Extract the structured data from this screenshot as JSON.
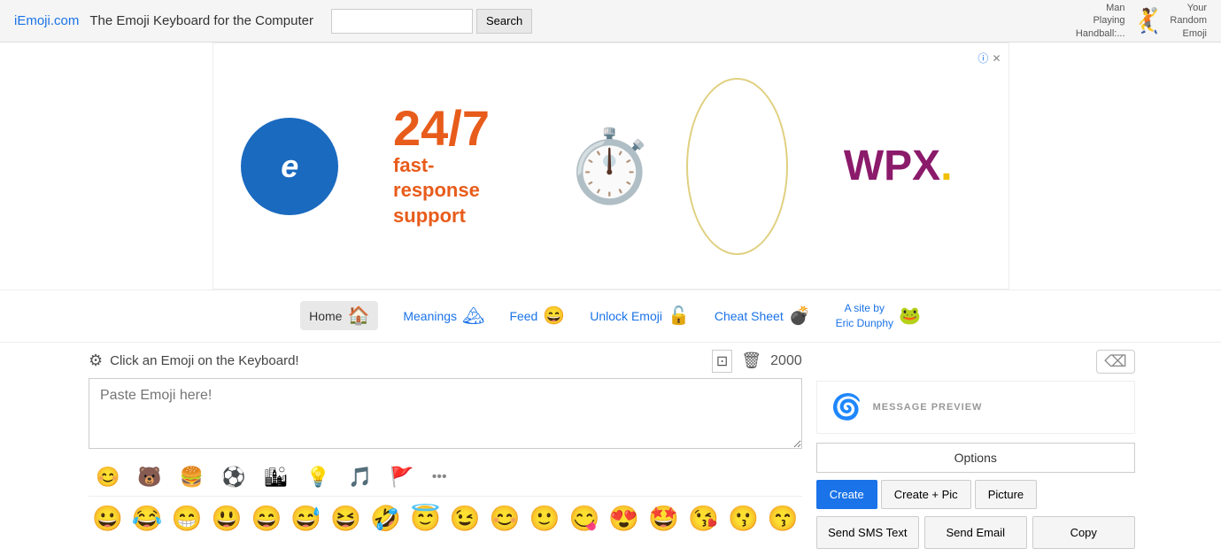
{
  "header": {
    "site_link": "iEmoji.com",
    "tagline": "The Emoji Keyboard for the Computer",
    "search_placeholder": "",
    "search_btn": "Search",
    "random_lines": [
      "Man",
      "Playing",
      "Handball:..."
    ],
    "random_label": "Your\nRandom\nEmoji",
    "random_emoji": "🤾"
  },
  "ad": {
    "highlight": "24/7",
    "support": "fast-response\nsupport",
    "brand": "WPX.",
    "close_label": "×",
    "info_label": "ⓘ"
  },
  "nav": {
    "items": [
      {
        "id": "home",
        "label": "Home",
        "emoji": "🏠",
        "active": true
      },
      {
        "id": "meanings",
        "label": "Meanings",
        "emoji": "🏔",
        "active": false
      },
      {
        "id": "feed",
        "label": "Feed",
        "emoji": "😄",
        "active": false
      },
      {
        "id": "unlock",
        "label": "Unlock Emoji",
        "emoji": "🔓",
        "active": false
      },
      {
        "id": "cheatsheet",
        "label": "Cheat Sheet",
        "emoji": "💣",
        "active": false
      },
      {
        "id": "siteby",
        "label": "A site by\nEric Dunphy",
        "emoji": "🐸",
        "active": false
      }
    ]
  },
  "keyboard": {
    "title": "Click an Emoji on the Keyboard!",
    "placeholder": "Paste Emoji here!",
    "char_count": "2000",
    "settings_icon": "⚙",
    "copy_icon": "⊡",
    "trash_icon": "🗑",
    "tabs": [
      "😊",
      "🐻",
      "🍔",
      "⚽",
      "🏙",
      "💡",
      "🎵",
      "🚩",
      "•••"
    ],
    "emoji_row1": [
      "😀",
      "😂",
      "😁",
      "😃",
      "😄",
      "😅",
      "😆",
      "🤣",
      "😇",
      "😉",
      "😊",
      "🙂",
      "😋",
      "😍",
      "🤩",
      "😘",
      "😗",
      "😙"
    ],
    "emoji_row1_extra": "..."
  },
  "panel": {
    "close_btn": "⌫",
    "preview_icon": "🌀",
    "preview_label": "MESSAGE PREVIEW",
    "options_label": "Options",
    "action_buttons": [
      {
        "id": "create",
        "label": "Create",
        "primary": true
      },
      {
        "id": "create-pic",
        "label": "Create + Pic",
        "primary": false
      },
      {
        "id": "picture",
        "label": "Picture",
        "primary": false
      }
    ],
    "bottom_buttons": [
      {
        "id": "sms",
        "label": "Send SMS Text"
      },
      {
        "id": "email",
        "label": "Send Email"
      },
      {
        "id": "copy",
        "label": "Copy"
      }
    ]
  }
}
